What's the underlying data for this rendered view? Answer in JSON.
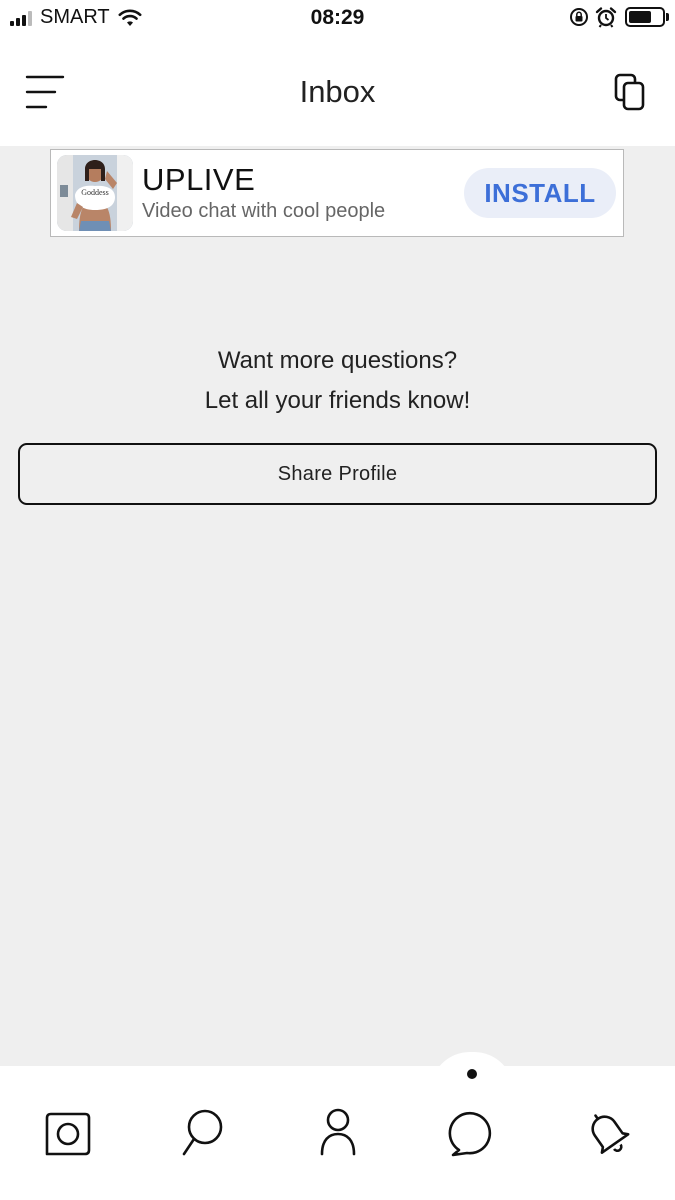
{
  "status_bar": {
    "carrier": "SMART",
    "time": "08:29",
    "battery_level": 0.8
  },
  "header": {
    "title": "Inbox",
    "menu_icon": "hamburger-menu-icon",
    "right_icon": "copy-icon"
  },
  "ad": {
    "title": "UPLIVE",
    "subtitle": "Video chat with cool people",
    "cta": "INSTALL",
    "image_shirt_text": "Goddess",
    "cta_color": "#3d6fd8"
  },
  "empty_state": {
    "line1": "Want more questions?",
    "line2": "Let all your friends know!",
    "button": "Share Profile"
  },
  "tabs": [
    {
      "icon": "camera-icon"
    },
    {
      "icon": "search-icon"
    },
    {
      "icon": "profile-icon"
    },
    {
      "icon": "chat-bubble-icon",
      "active": true
    },
    {
      "icon": "bell-icon"
    }
  ],
  "colors": {
    "background": "#efefef",
    "surface": "#ffffff",
    "text": "#111111"
  }
}
